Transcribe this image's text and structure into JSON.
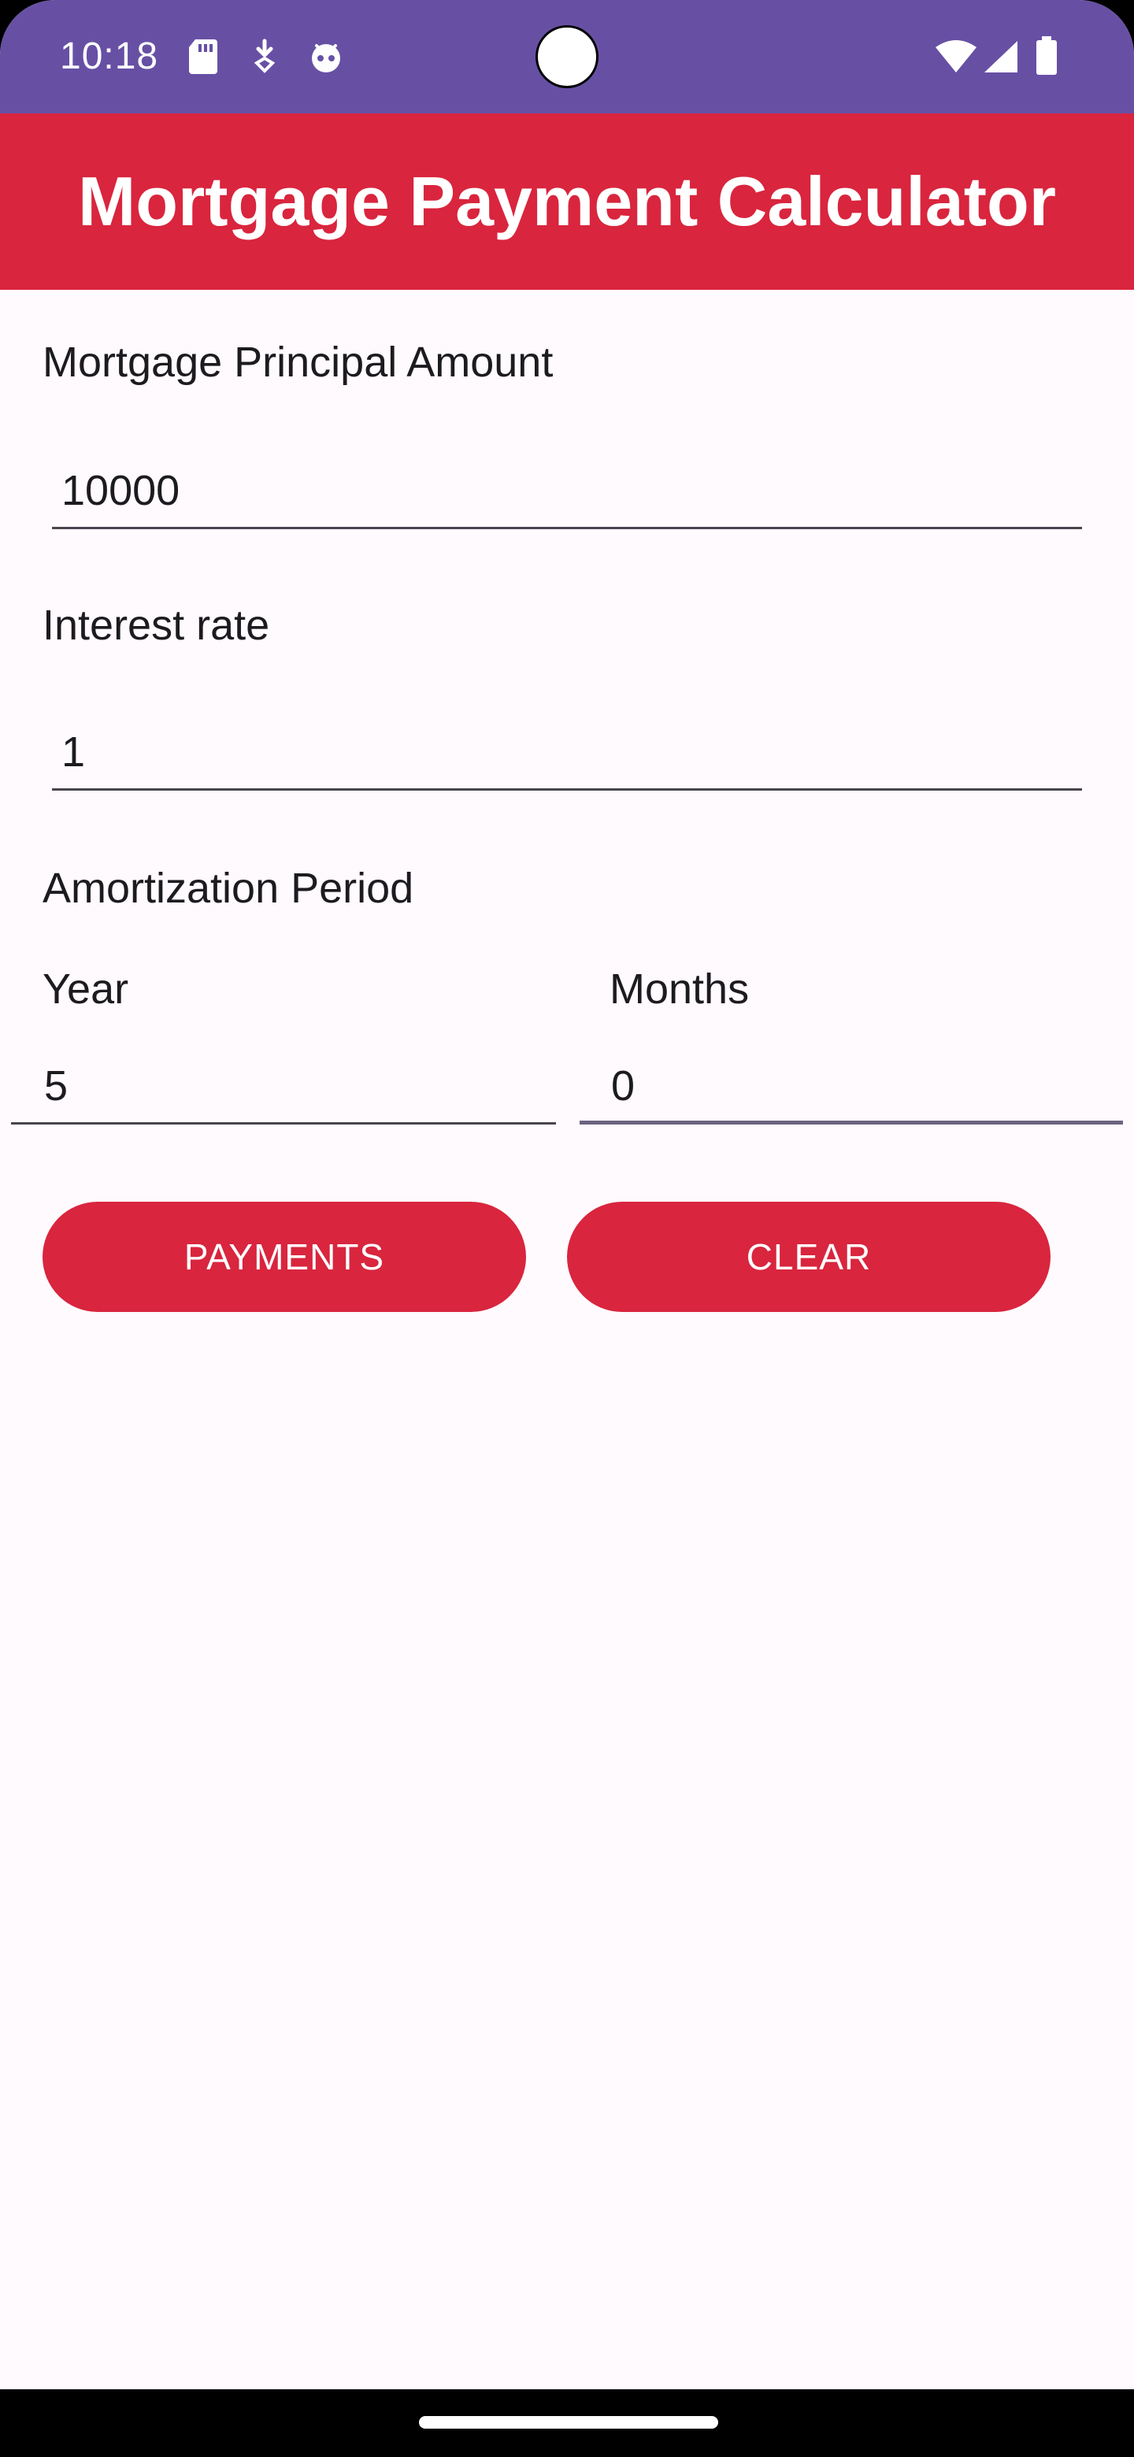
{
  "status_bar": {
    "time": "10:18",
    "left_icons": [
      "sd-card-icon",
      "download-icon",
      "android-head-icon"
    ],
    "right_icons": [
      "wifi-icon",
      "cellular-signal-icon",
      "battery-icon"
    ]
  },
  "app_bar": {
    "title": "Mortgage Payment Calculator"
  },
  "form": {
    "principal_label": "Mortgage Principal Amount",
    "principal_value": "10000",
    "interest_label": "Interest rate",
    "interest_value": "1",
    "amortization_label": "Amortization Period",
    "year_label": "Year",
    "year_value": "5",
    "months_label": "Months",
    "months_value": "0"
  },
  "buttons": {
    "payments_label": "PAYMENTS",
    "clear_label": "CLEAR"
  },
  "colors": {
    "status_bar": "#6750a4",
    "accent": "#d9253e",
    "background": "#fefafe"
  }
}
